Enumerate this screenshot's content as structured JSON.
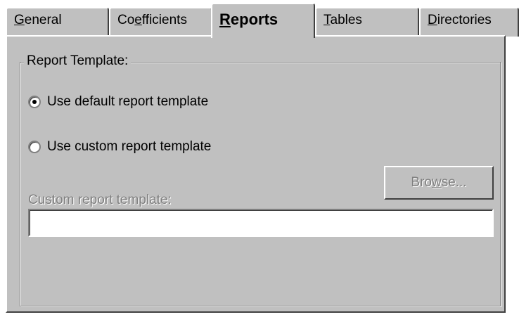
{
  "tabs": [
    {
      "pre": "",
      "accel": "G",
      "post": "eneral"
    },
    {
      "pre": "Co",
      "accel": "e",
      "post": "fficients"
    },
    {
      "pre": "",
      "accel": "R",
      "post": "eports"
    },
    {
      "pre": "",
      "accel": "T",
      "post": "ables"
    },
    {
      "pre": "",
      "accel": "D",
      "post": "irectories"
    }
  ],
  "group": {
    "title": "Report Template:"
  },
  "options": {
    "default_label": "Use default report template",
    "custom_label": "Use custom report template",
    "selected": "default"
  },
  "custom": {
    "label": "Custom report template:",
    "value": "",
    "browse": {
      "pre": "Bro",
      "accel": "w",
      "post": "se..."
    }
  },
  "colors": {
    "face": "#c0c0c0",
    "shadow": "#808080",
    "highlight": "#ffffff",
    "disabled_text": "#808080"
  }
}
